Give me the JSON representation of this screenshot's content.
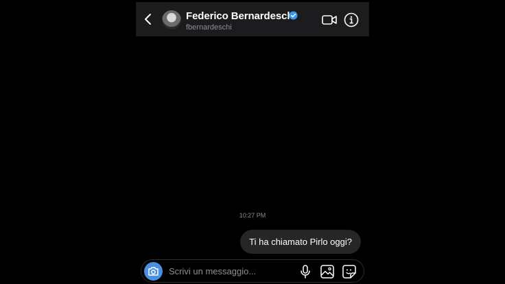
{
  "header": {
    "name": "Federico Bernardeschi",
    "username": "fbernardeschi",
    "verified": true
  },
  "conversation": {
    "timestamp": "10:27 PM",
    "messages": [
      {
        "sender": "me",
        "text": "Ti ha chiamato Pirlo oggi?"
      }
    ]
  },
  "composer": {
    "placeholder": "Scrivi un messaggio...",
    "value": ""
  },
  "icons": {
    "back": "chevron-left-icon",
    "video": "video-camera-icon",
    "info": "info-icon",
    "camera": "camera-icon",
    "mic": "microphone-icon",
    "gallery": "image-icon",
    "sticker": "sticker-icon",
    "verified": "verified-badge-icon"
  },
  "colors": {
    "background": "#000000",
    "header_bg": "#1c1c1e",
    "bubble_bg": "#262626",
    "camera_button": "#4a90e2",
    "verified_badge": "#3897f0",
    "muted_text": "#8e8e93"
  }
}
